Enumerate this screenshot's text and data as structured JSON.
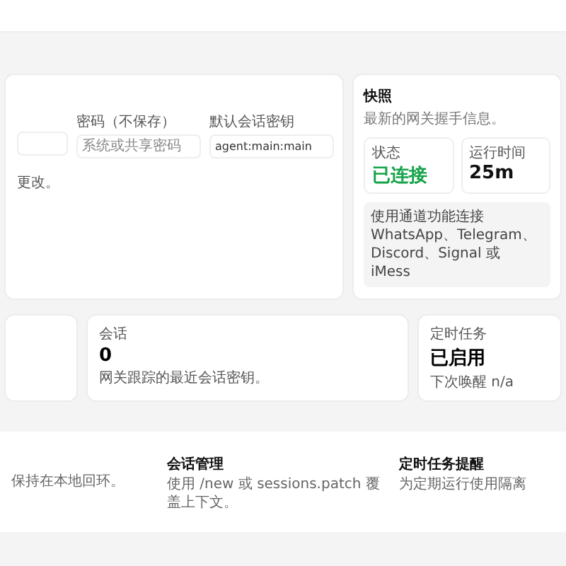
{
  "access_card": {
    "fields": [
      {
        "kind": "text"
      },
      {
        "kind": "text",
        "label": "密码（不保存）",
        "placeholder": "系统或共享密码"
      },
      {
        "kind": "text",
        "label": "默认会话密钥",
        "value": "agent:main:main"
      }
    ],
    "note": "更改。"
  },
  "snapshot_card": {
    "title": "快照",
    "subtitle": "最新的网关握手信息。",
    "stats": [
      {
        "label": "状态",
        "value": "已连接",
        "color": "#16a34a"
      },
      {
        "label": "运行时间",
        "value": "25m",
        "color": "#111111"
      }
    ],
    "notice": "使用通道功能连接 WhatsApp、Telegram、Discord、Signal 或 iMess"
  },
  "metric_cards": [
    {
      "label": "会话",
      "value": "0",
      "hint": "网关跟踪的最近会话密钥。"
    },
    {
      "label": "定时任务",
      "value": "已启用",
      "hint": "下次唤醒 n/a"
    }
  ],
  "notes": [
    {
      "text": "保持在本地回环。"
    },
    {
      "title": "会话管理",
      "text": "使用 /new 或 sessions.patch 覆盖上下文。"
    },
    {
      "title": "定时任务提醒",
      "text": "为定期运行使用隔离"
    }
  ]
}
